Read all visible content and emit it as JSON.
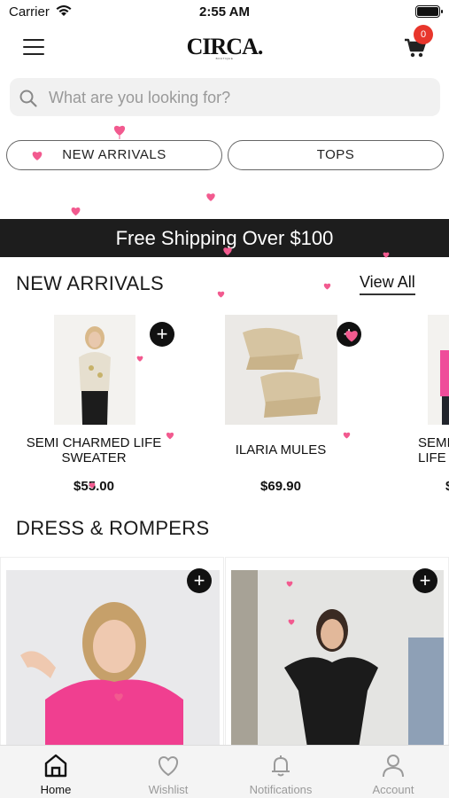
{
  "status_bar": {
    "carrier": "Carrier",
    "time": "2:55 AM"
  },
  "header": {
    "logo": "CIRCA.",
    "logo_sub": "BOUTIQUE",
    "cart_count": "0"
  },
  "search": {
    "placeholder": "What are you looking for?"
  },
  "categories": [
    {
      "label": "NEW ARRIVALS"
    },
    {
      "label": "TOPS"
    }
  ],
  "banner": {
    "text": "Free Shipping Over $100"
  },
  "new_arrivals": {
    "title": "NEW ARRIVALS",
    "view_all": "View All",
    "products": [
      {
        "name": "SEMI CHARMED LIFE SWEATER",
        "price": "$55.00"
      },
      {
        "name": "ILARIA MULES",
        "price": "$69.90"
      },
      {
        "name": "SEMI CHARMED LIFE",
        "price": "$"
      }
    ]
  },
  "dresses": {
    "title": "DRESS & ROMPERS"
  },
  "tabs": [
    {
      "label": "Home",
      "icon": "home-icon",
      "active": true
    },
    {
      "label": "Wishlist",
      "icon": "heart-icon",
      "active": false
    },
    {
      "label": "Notifications",
      "icon": "bell-icon",
      "active": false
    },
    {
      "label": "Account",
      "icon": "person-icon",
      "active": false
    }
  ],
  "colors": {
    "accent_badge": "#e8362c",
    "banner_bg": "#1d1d1d",
    "confetti_heart": "#f25a8f"
  }
}
